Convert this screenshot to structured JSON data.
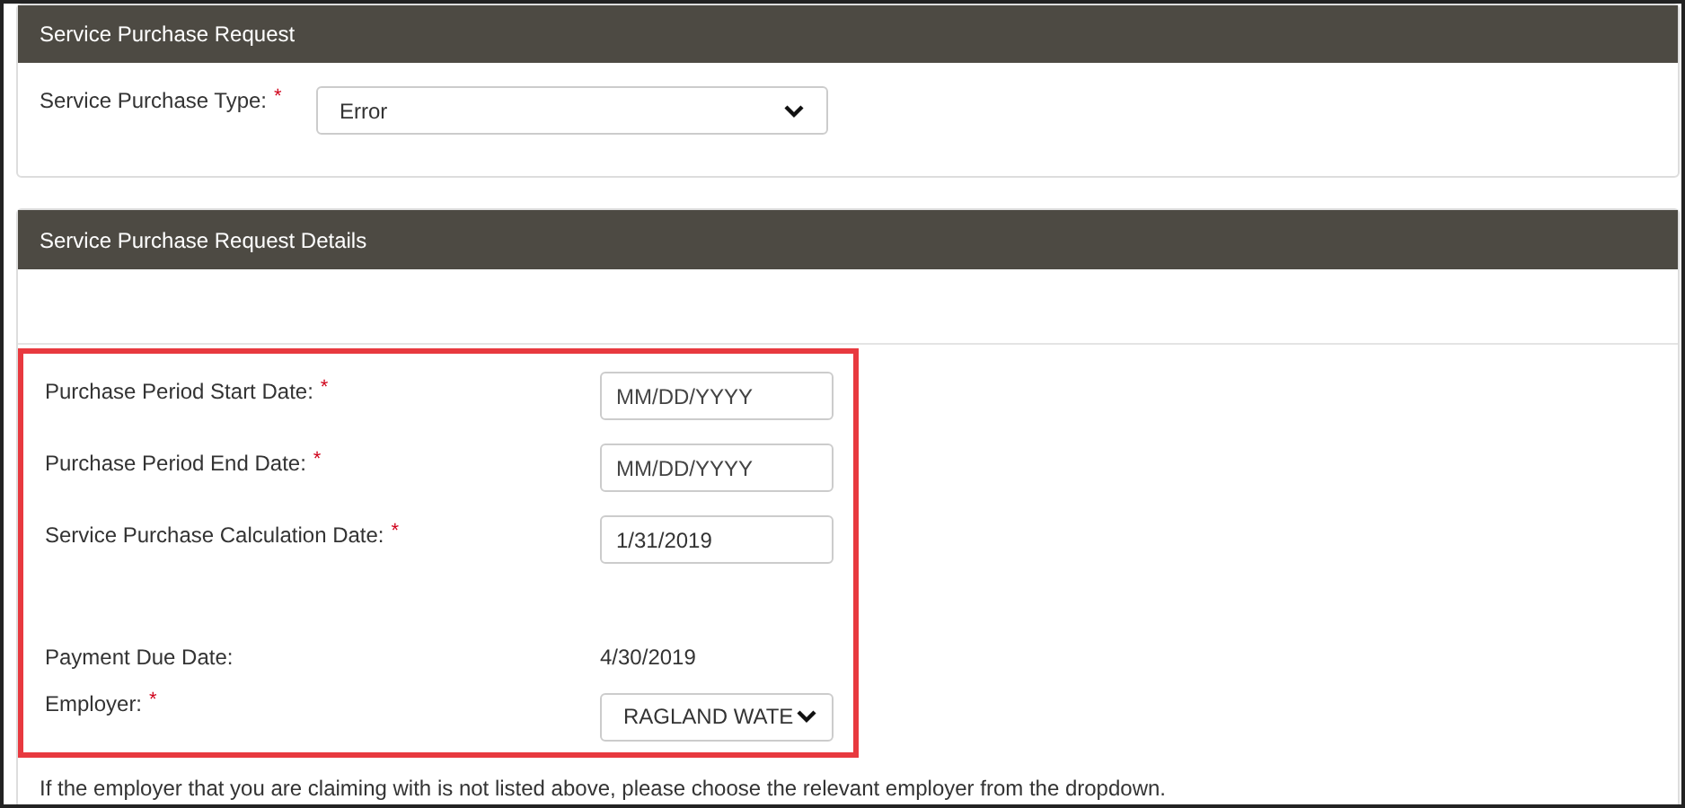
{
  "sections": [
    {
      "title": "Service Purchase Request",
      "fields": [
        {
          "kind": "select",
          "label": "Service Purchase Type:",
          "required_mark": "*",
          "value": "Error"
        }
      ]
    },
    {
      "title": "Service Purchase Request Details",
      "highlighted": true,
      "fields": [
        {
          "kind": "input",
          "label": "Purchase Period Start Date:",
          "required_mark": "*",
          "placeholder": "MM/DD/YYYY"
        },
        {
          "kind": "input",
          "label": "Purchase Period End Date:",
          "required_mark": "*",
          "placeholder": "MM/DD/YYYY"
        },
        {
          "kind": "input",
          "label": "Service Purchase Calculation Date:",
          "required_mark": "*",
          "value": "1/31/2019"
        },
        {
          "kind": "text",
          "label": "Payment Due Date:",
          "value": "4/30/2019"
        },
        {
          "kind": "select",
          "label": "Employer:",
          "required_mark": "*",
          "value": "RAGLAND WATE"
        }
      ],
      "help_text": "If the employer that you are claiming with is not listed above, please choose the relevant employer from the dropdown."
    }
  ]
}
